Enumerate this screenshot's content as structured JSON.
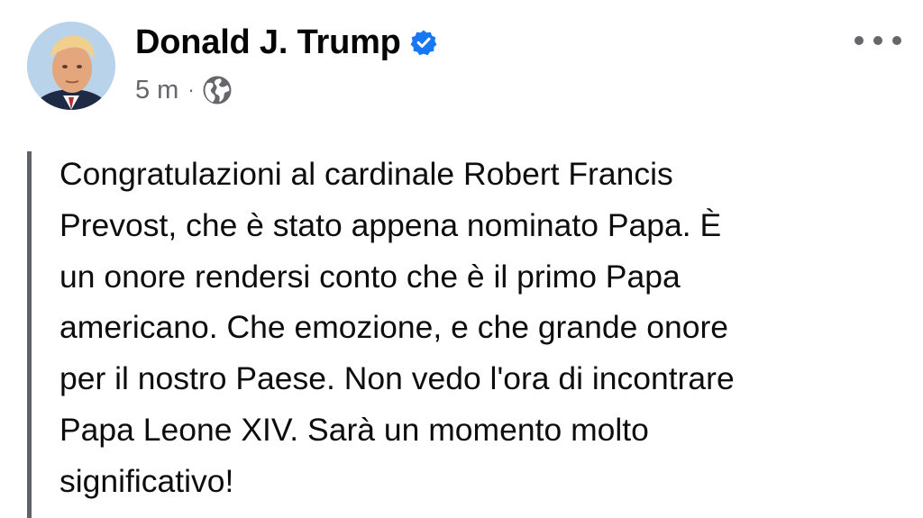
{
  "post": {
    "author_name": "Donald J. Trump",
    "timestamp": "5 m",
    "separator": "·",
    "audience_icon": "globe-icon",
    "verified_icon": "verified-badge-icon",
    "more_icon": "more-options-icon",
    "body": "Congratulazioni al cardinale Robert Francis\nPrevost, che è stato appena nominato Papa. È\nun onore rendersi conto che è il primo Papa\namericano. Che emozione, e che grande onore\nper il nostro Paese. Non vedo l'ora di incontrare\nPapa Leone XIV. Sarà un momento molto\nsignificativo!"
  },
  "colors": {
    "verified_blue": "#1877f2",
    "meta_gray": "#65676b",
    "quote_bar": "#5f6368",
    "text": "#050505"
  }
}
